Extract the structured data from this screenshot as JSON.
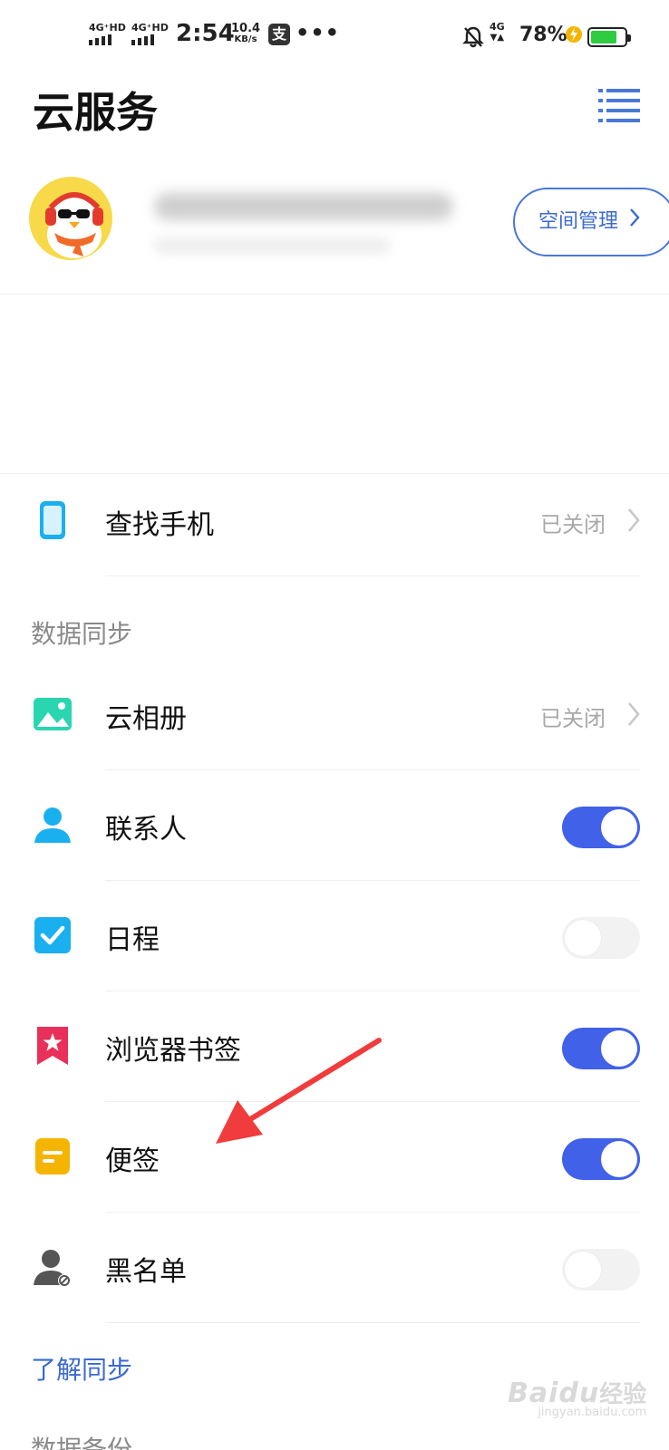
{
  "status_bar": {
    "sim1": "4G⁺HD",
    "sim2": "4G⁺HD",
    "time": "2:54",
    "speed_value": "10.4",
    "speed_unit": "KB/s",
    "alipay_glyph": "支",
    "more_dots": "•••",
    "network": "4G",
    "battery_percent": "78%",
    "battery_level": 0.78,
    "battery_color": "#2ecc40"
  },
  "header": {
    "title": "云服务",
    "menu_icon": "list-menu-icon",
    "accent": "#4a78d6"
  },
  "account": {
    "avatar_icon": "penguin-avatar",
    "space_button_label": "空间管理"
  },
  "rows": {
    "find_phone": {
      "label": "查找手机",
      "status": "已关闭",
      "icon": "phone-icon"
    }
  },
  "sync": {
    "section_label": "数据同步",
    "items": [
      {
        "label": "云相册",
        "status": "已关闭",
        "icon": "photo-icon",
        "icon_color": "#2ad6b0"
      },
      {
        "label": "联系人",
        "toggle": true,
        "icon": "contact-icon",
        "icon_color": "#1ab0f0"
      },
      {
        "label": "日程",
        "toggle": false,
        "icon": "calendar-check-icon",
        "icon_color": "#1ab0f0"
      },
      {
        "label": "浏览器书签",
        "toggle": true,
        "icon": "bookmark-icon",
        "icon_color": "#e8305a"
      },
      {
        "label": "便签",
        "toggle": true,
        "icon": "note-icon",
        "icon_color": "#f5b400"
      },
      {
        "label": "黑名单",
        "toggle": false,
        "icon": "blacklist-icon",
        "icon_color": "#555555"
      }
    ],
    "toggle_on_color": "#4161e8",
    "learn_link": "了解同步"
  },
  "backup": {
    "section_label": "数据备份"
  },
  "watermark": {
    "brand": "Bai",
    "brand_paw": "du",
    "brand_cn": "经验",
    "url": "jingyan.baidu.com"
  },
  "annotation": {
    "arrow_color": "#f03c3c"
  }
}
